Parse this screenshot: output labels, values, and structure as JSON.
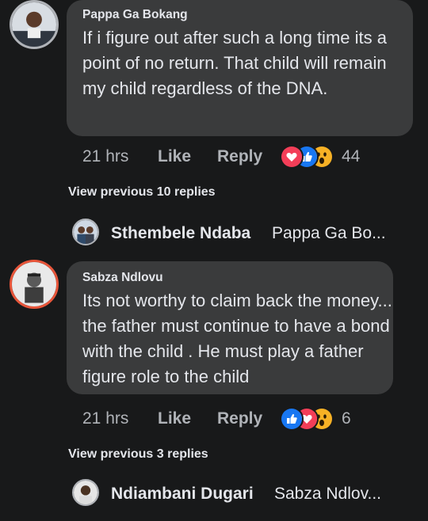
{
  "comments": [
    {
      "author": "Pappa Ga Bokang",
      "text": "If i figure out after such a long time its a point of no return. That child will remain my child regardless of the DNA.",
      "time": "21 hrs",
      "like_label": "Like",
      "reply_label": "Reply",
      "reaction_icons": [
        "love-icon",
        "like-icon",
        "wow-icon"
      ],
      "reaction_count": "44",
      "view_previous": "View previous 10 replies",
      "latest_reply": {
        "author": "Sthembele Ndaba",
        "preview": "Pappa Ga Bo..."
      }
    },
    {
      "author": "Sabza Ndlovu",
      "text": "Its not worthy to claim back the money... the father  must continue  to have a bond with the child . He must play a father figure  role to the child",
      "time": "21 hrs",
      "like_label": "Like",
      "reply_label": "Reply",
      "reaction_icons": [
        "like-icon",
        "love-icon",
        "wow-icon"
      ],
      "reaction_count": "6",
      "view_previous": "View previous 3 replies",
      "latest_reply": {
        "author": "Ndiambani Dugari",
        "preview": "Sabza Ndlov..."
      }
    }
  ],
  "colors": {
    "background": "#18191a",
    "bubble": "#3a3b3c",
    "text": "#e4e6eb",
    "secondary_text": "#b0b3b8",
    "like_blue": "#1877f2",
    "love_red": "#f33e58",
    "wow_yellow": "#f7b125"
  }
}
